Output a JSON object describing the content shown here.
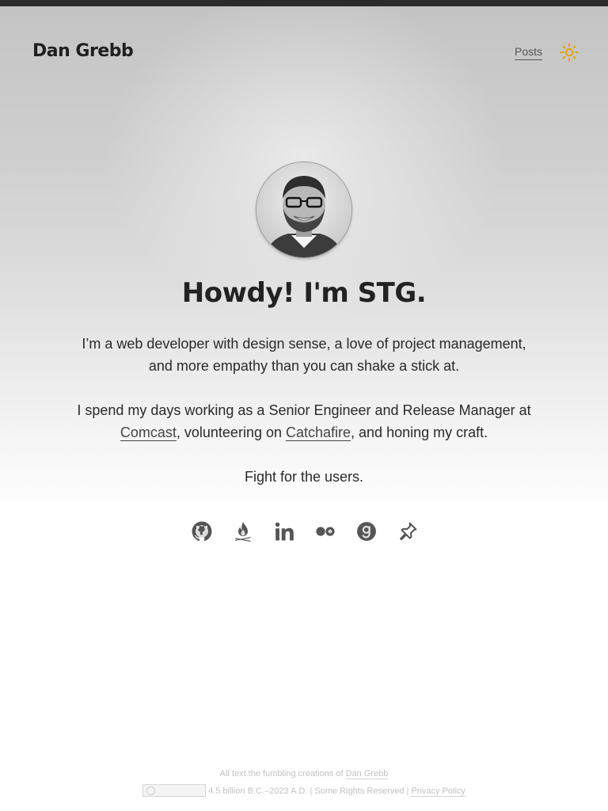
{
  "header": {
    "site_title": "Dan Grebb",
    "nav": {
      "posts_label": "Posts"
    },
    "theme_toggle_icon": "sun-icon",
    "accent_color": "#e0a100"
  },
  "hero": {
    "headline": "Howdy! I'm STG.",
    "intro": "I’m a web developer with design sense, a love of project management, and more empathy than you can shake a stick at.",
    "work": {
      "before": "I spend my days working as a Senior Engineer and Release Manager at ",
      "link1": "Comcast",
      "middle": ", volunteering on ",
      "link2": "Catchafire",
      "after": ", and honing my craft."
    },
    "motto": "Fight for the users."
  },
  "social": [
    {
      "icon": "github-icon"
    },
    {
      "icon": "campfire-icon"
    },
    {
      "icon": "linkedin-icon"
    },
    {
      "icon": "flickr-icon"
    },
    {
      "icon": "goodreads-icon"
    },
    {
      "icon": "pin-icon"
    }
  ],
  "footer": {
    "line1_text": "All text the fumbling creations of ",
    "line1_link": "Dan Grebb",
    "license_badge_icon": "creative-commons-badge",
    "line2_text": "4.5 billion B.C.–2023 A.D. | Some Rights Reserved | ",
    "line2_link": "Privacy Policy"
  }
}
